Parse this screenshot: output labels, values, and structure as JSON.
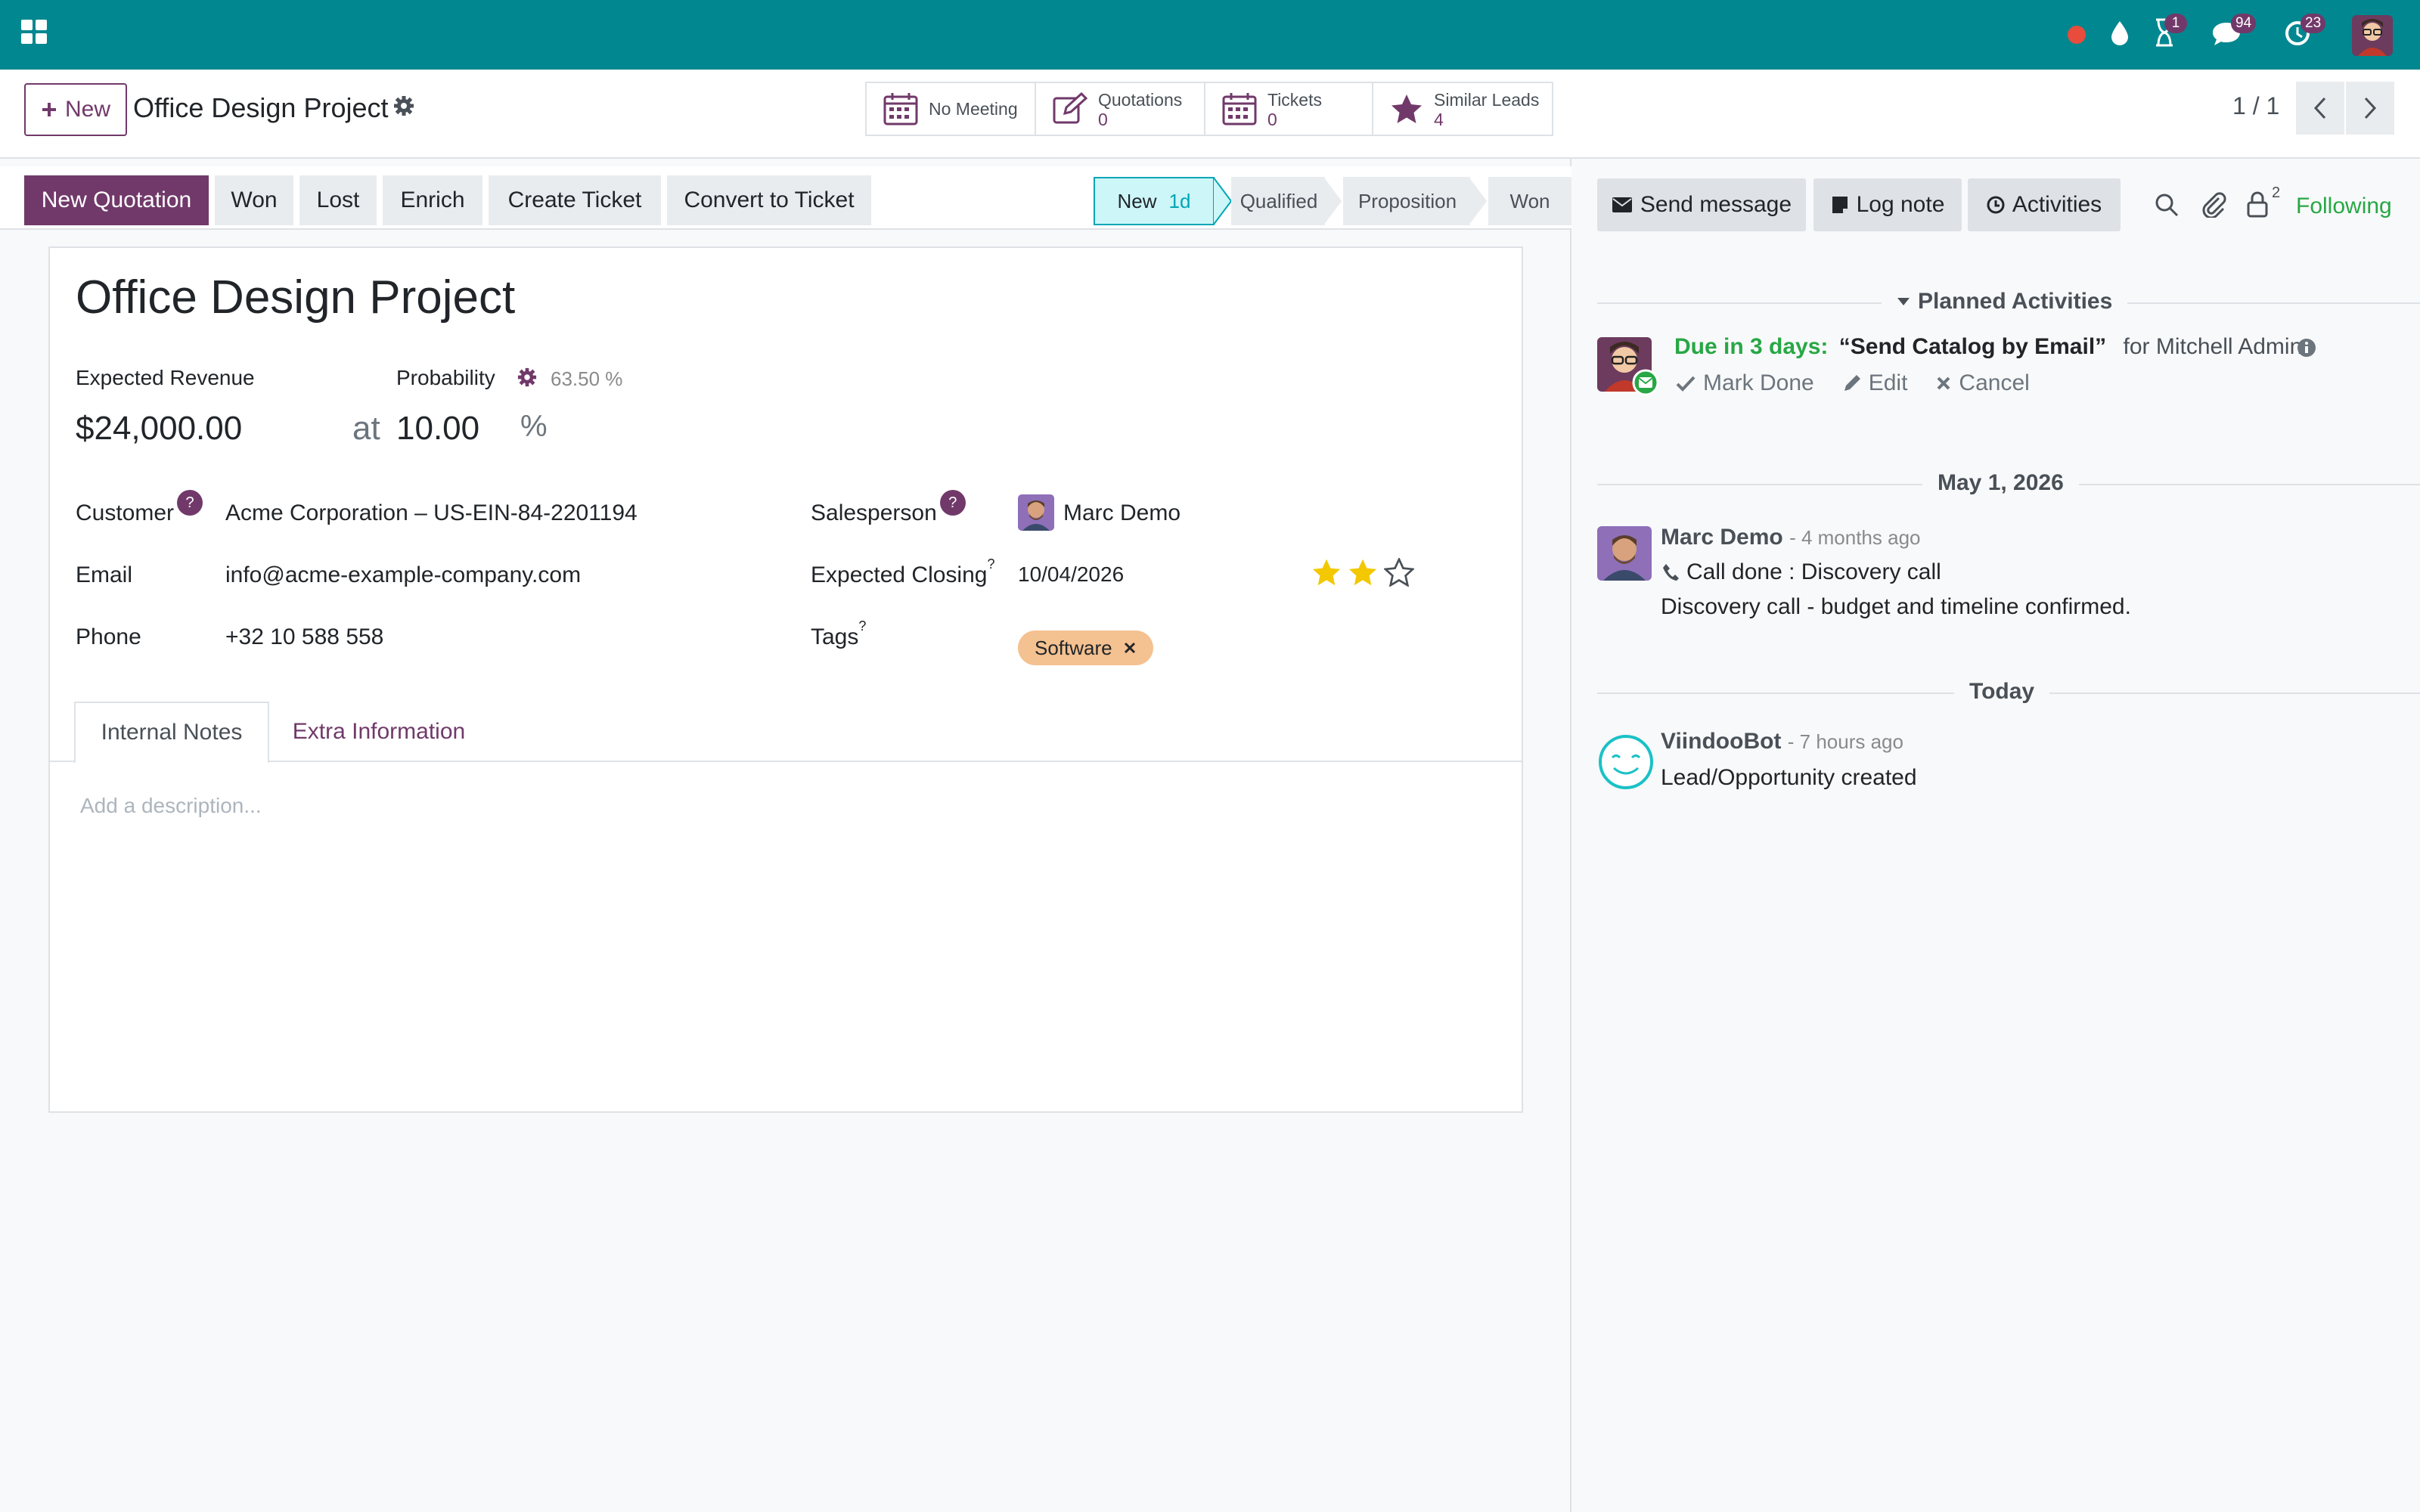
{
  "navbar": {
    "activity_badge": "1",
    "messages_badge": "94",
    "timer_badge": "23"
  },
  "control": {
    "new_label": "New",
    "record_title": "Office Design Project",
    "pager": "1 / 1",
    "smart_buttons": [
      {
        "label": "No Meeting",
        "value": ""
      },
      {
        "label": "Quotations",
        "value": "0"
      },
      {
        "label": "Tickets",
        "value": "0"
      },
      {
        "label": "Similar Leads",
        "value": "4"
      }
    ]
  },
  "statusbar": {
    "buttons": [
      "New Quotation",
      "Won",
      "Lost",
      "Enrich",
      "Create Ticket",
      "Convert to Ticket"
    ],
    "stages": [
      {
        "label": "New",
        "duration": "1d"
      },
      {
        "label": "Qualified"
      },
      {
        "label": "Proposition"
      },
      {
        "label": "Won"
      }
    ]
  },
  "form": {
    "title": "Office Design Project",
    "expected_revenue_label": "Expected Revenue",
    "expected_revenue": "$24,000.00",
    "at_label": "at",
    "probability_label": "Probability",
    "probability_auto": "63.50 %",
    "probability": "10.00",
    "percent_sign": "%",
    "customer_label": "Customer",
    "customer": "Acme Corporation – US-EIN-84-2201194",
    "email_label": "Email",
    "email": "info@acme-example-company.com",
    "phone_label": "Phone",
    "phone": "+32 10 588 558",
    "salesperson_label": "Salesperson",
    "salesperson": "Marc Demo",
    "closing_label": "Expected Closing",
    "closing": "10/04/2026",
    "priority_stars": 2,
    "priority_max": 3,
    "tags_label": "Tags",
    "tag": "Software",
    "tabs": [
      "Internal Notes",
      "Extra Information"
    ],
    "description_placeholder": "Add a description..."
  },
  "chatter": {
    "send_message": "Send message",
    "log_note": "Log note",
    "activities": "Activities",
    "followers_count": "2",
    "following": "Following",
    "planned_title": "Planned Activities",
    "activity": {
      "due": "Due in 3 days:",
      "summary": "“Send Catalog by Email”",
      "for": "for Mitchell Admin",
      "mark_done": "Mark Done",
      "edit": "Edit",
      "cancel": "Cancel"
    },
    "date_sep_1": "May 1, 2026",
    "msg1": {
      "author": "Marc Demo",
      "time": "- 4 months ago",
      "line1": "Call done : Discovery call",
      "line2": "Discovery call - budget and timeline confirmed."
    },
    "date_sep_2": "Today",
    "msg2": {
      "author": "ViindooBot",
      "time": "- 7 hours ago",
      "line1": "Lead/Opportunity created"
    }
  },
  "colors": {
    "navbar": "#018790",
    "primary": "#71396a",
    "success": "#28a745",
    "tag": "#f4c190",
    "star": "#f3c800"
  }
}
